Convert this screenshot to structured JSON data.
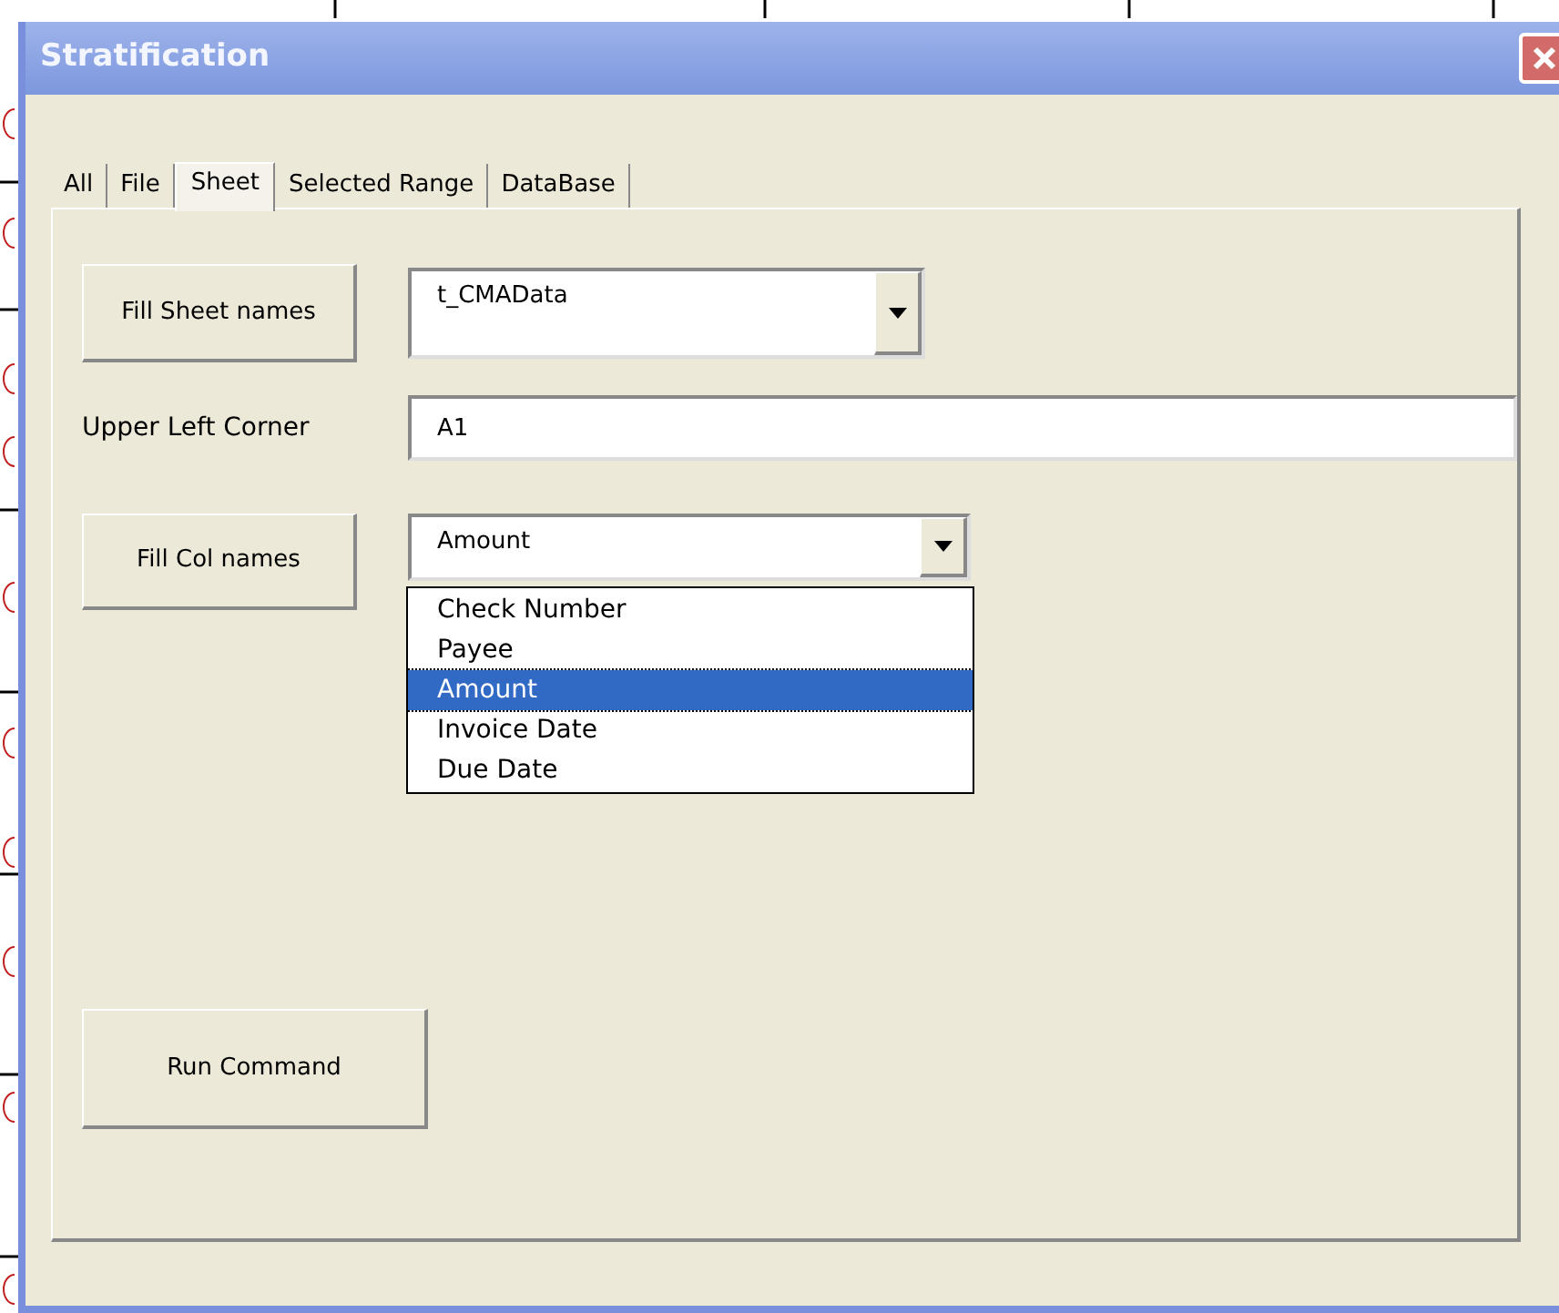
{
  "window": {
    "title": "Stratification"
  },
  "tabs": [
    {
      "label": "All",
      "selected": false
    },
    {
      "label": "File",
      "selected": false
    },
    {
      "label": "Sheet",
      "selected": true
    },
    {
      "label": "Selected Range",
      "selected": false
    },
    {
      "label": "DataBase",
      "selected": false
    }
  ],
  "sheet_names": {
    "button": "Fill Sheet names",
    "value": "t_CMAData"
  },
  "upper_left_corner": {
    "label": "Upper Left Corner",
    "value": "A1"
  },
  "col_names": {
    "button": "Fill Col names",
    "value": "Amount",
    "expanded": true,
    "options": [
      {
        "label": "Check Number",
        "selected": false
      },
      {
        "label": "Payee",
        "selected": false
      },
      {
        "label": "Amount",
        "selected": true
      },
      {
        "label": "Invoice Date",
        "selected": false
      },
      {
        "label": "Due Date",
        "selected": false
      }
    ]
  },
  "run_button": "Run Command"
}
